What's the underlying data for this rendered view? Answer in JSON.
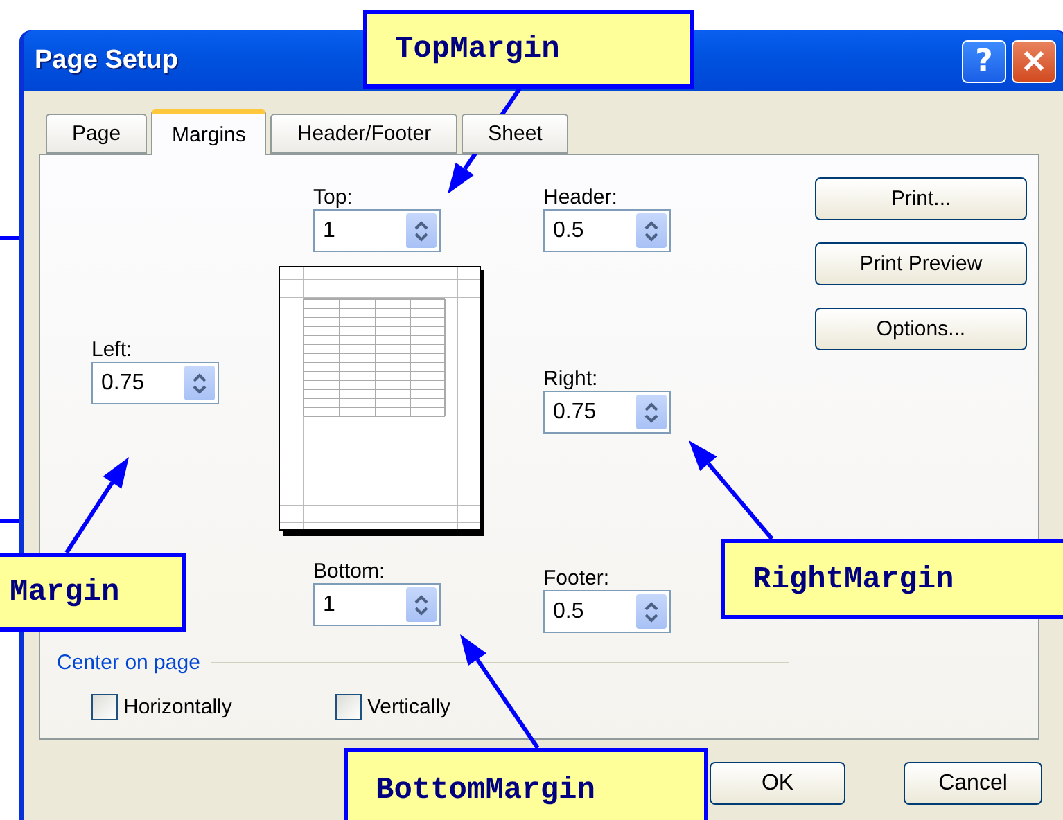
{
  "window": {
    "title": "Page Setup",
    "help_label": "?"
  },
  "tabs": [
    {
      "label": "Page",
      "selected": false
    },
    {
      "label": "Margins",
      "selected": true
    },
    {
      "label": "Header/Footer",
      "selected": false
    },
    {
      "label": "Sheet",
      "selected": false
    }
  ],
  "margins": {
    "top": {
      "label": "Top:",
      "value": "1"
    },
    "header": {
      "label": "Header:",
      "value": "0.5"
    },
    "left": {
      "label": "Left:",
      "value": "0.75"
    },
    "right": {
      "label": "Right:",
      "value": "0.75"
    },
    "bottom": {
      "label": "Bottom:",
      "value": "1"
    },
    "footer": {
      "label": "Footer:",
      "value": "0.5"
    }
  },
  "center_on_page": {
    "title": "Center on page",
    "options": [
      {
        "label": "Horizontally",
        "checked": false
      },
      {
        "label": "Vertically",
        "checked": false
      }
    ]
  },
  "side_buttons": [
    "Print...",
    "Print Preview",
    "Options..."
  ],
  "dialog_buttons": [
    "OK",
    "Cancel"
  ],
  "annotations": [
    {
      "kind": "top",
      "text": "TopMargin"
    },
    {
      "kind": "left",
      "text": "Margin"
    },
    {
      "kind": "right",
      "text": "RightMargin"
    },
    {
      "kind": "bottom",
      "text": "BottomMargin"
    }
  ]
}
